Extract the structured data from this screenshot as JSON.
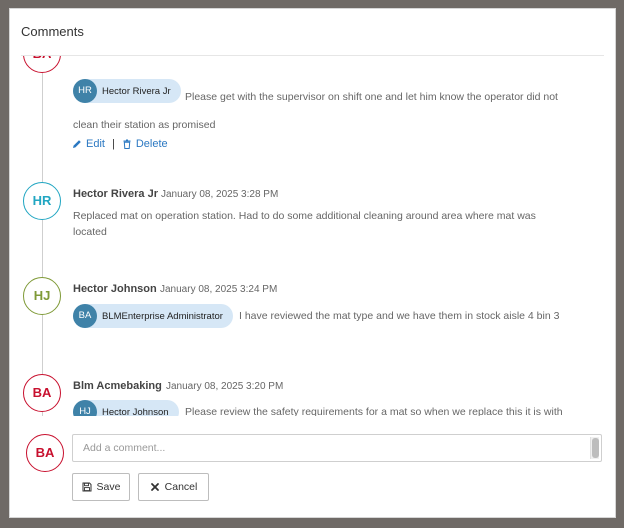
{
  "panel": {
    "title": "Comments"
  },
  "comments": [
    {
      "avatar": "BA",
      "mention": {
        "initials": "HR",
        "name": "Hector Rivera Jr"
      },
      "text": "Please get with the supervisor on shift one and let him know the operator did not clean their station as promised",
      "actions": {
        "edit": "Edit",
        "separator": "|",
        "delete": "Delete"
      }
    },
    {
      "avatar": "HR",
      "author": "Hector Rivera Jr",
      "date": "January 08, 2025 3:28 PM",
      "text": "Replaced mat on operation station. Had to do some additional cleaning around area where mat was located"
    },
    {
      "avatar": "HJ",
      "author": "Hector Johnson",
      "date": "January 08, 2025 3:24 PM",
      "mention": {
        "initials": "BA",
        "name": "BLMEnterprise Administrator"
      },
      "text": "I have reviewed the mat type and we have them in stock aisle 4 bin 3"
    },
    {
      "avatar": "BA",
      "author": "Blm Acmebaking",
      "date": "January 08, 2025 3:20 PM",
      "mention": {
        "initials": "HJ",
        "name": "Hector Johnson"
      },
      "text": "Please review the safety requirements for a mat so when we replace this it is with"
    }
  ],
  "composer": {
    "avatar": "BA",
    "placeholder": "Add a comment...",
    "save_label": "Save",
    "cancel_label": "Cancel"
  },
  "colors": {
    "red": "#c8102e",
    "teal": "#21a6c2",
    "olive": "#7f9a37",
    "link": "#2b78c2",
    "chip_bg": "#d6e7f6",
    "chip_avatar": "#3f82a8"
  },
  "icons": {
    "edit": "pencil-icon",
    "delete": "trash-icon",
    "save": "floppy-disk-icon",
    "cancel": "close-icon"
  }
}
